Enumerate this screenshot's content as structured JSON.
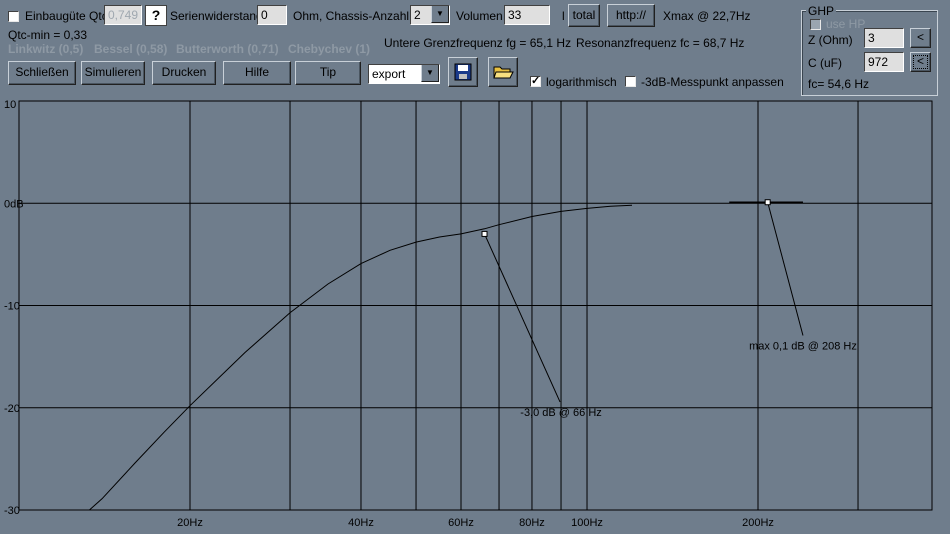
{
  "header": {
    "einbau_label": "Einbaugüte Qtc",
    "qtc_value": "0,749",
    "help_btn": "?",
    "serien_label": "Serienwiderstand",
    "serien_value": "0",
    "ohm_label": "Ohm, Chassis-Anzahl",
    "chassis_value": "2",
    "volumen_label": "Volumen",
    "volumen_value": "33",
    "liter_label": "l",
    "total_btn": "total",
    "http_btn": "http://",
    "xmax_text": "Xmax @ 22,7Hz",
    "qtc_min": "Qtc-min = 0,33",
    "presets": [
      "Linkwitz (0,5)",
      "Bessel (0,58)",
      "Butterworth (0,71)",
      "Chebychev (1)"
    ],
    "fg_text": "Untere Grenzfrequenz fg = 65,1 Hz",
    "fc_text": "Resonanzfrequenz fc = 68,7 Hz"
  },
  "toolbar": {
    "close_btn": "Schließen",
    "simulate_btn": "Simulieren",
    "print_btn": "Drucken",
    "help_btn": "Hilfe",
    "tip_btn": "Tip",
    "export_value": "export",
    "log_label": "logarithmisch",
    "log_checked": true,
    "measure_label": "-3dB-Messpunkt anpassen",
    "measure_checked": false
  },
  "ghp": {
    "title": "GHP",
    "use_hp_label": "use HP",
    "z_label": "Z (Ohm)",
    "z_value": "3",
    "c_label": "C (uF)",
    "c_value": "972",
    "arrow": "<",
    "fc_text": "fc= 54,6 Hz"
  },
  "chart_data": {
    "type": "line",
    "xscale": "log",
    "xlim": [
      10,
      300
    ],
    "ylim": [
      -30,
      10
    ],
    "yticks": [
      10,
      0,
      -10,
      -20,
      -30
    ],
    "ytick_labels": [
      "10",
      "0dB",
      "-10",
      "-20",
      "-30"
    ],
    "xticks": [
      20,
      40,
      60,
      80,
      100,
      200
    ],
    "xtick_labels": [
      "20Hz",
      "40Hz",
      "60Hz",
      "80Hz",
      "100Hz",
      "200Hz"
    ],
    "x_gridlines": [
      20,
      30,
      40,
      50,
      60,
      70,
      80,
      90,
      100,
      200,
      300
    ],
    "series": [
      {
        "x": [
          13.3,
          14,
          16,
          18,
          20,
          25,
          30,
          35,
          40,
          45,
          50,
          55,
          60,
          66,
          70,
          80,
          90,
          100,
          110,
          120
        ],
        "y": [
          -30,
          -28.9,
          -25.4,
          -22.4,
          -19.8,
          -14.6,
          -10.7,
          -7.9,
          -5.9,
          -4.6,
          -3.8,
          -3.3,
          -3.0,
          -2.5,
          -2.1,
          -1.3,
          -0.8,
          -0.5,
          -0.3,
          -0.2
        ]
      }
    ],
    "segment2": {
      "x": [
        178,
        240
      ],
      "y": [
        0.1,
        0.1
      ]
    },
    "annotations": [
      {
        "text": "-3,0 dB @ 66 Hz",
        "x": 66,
        "y": -3.0,
        "label_x": 90,
        "label_y": -20.8
      },
      {
        "text": "max 0,1 dB @ 208 Hz",
        "x": 208,
        "y": 0.1,
        "label_x": 240,
        "label_y": -14.3
      }
    ]
  }
}
